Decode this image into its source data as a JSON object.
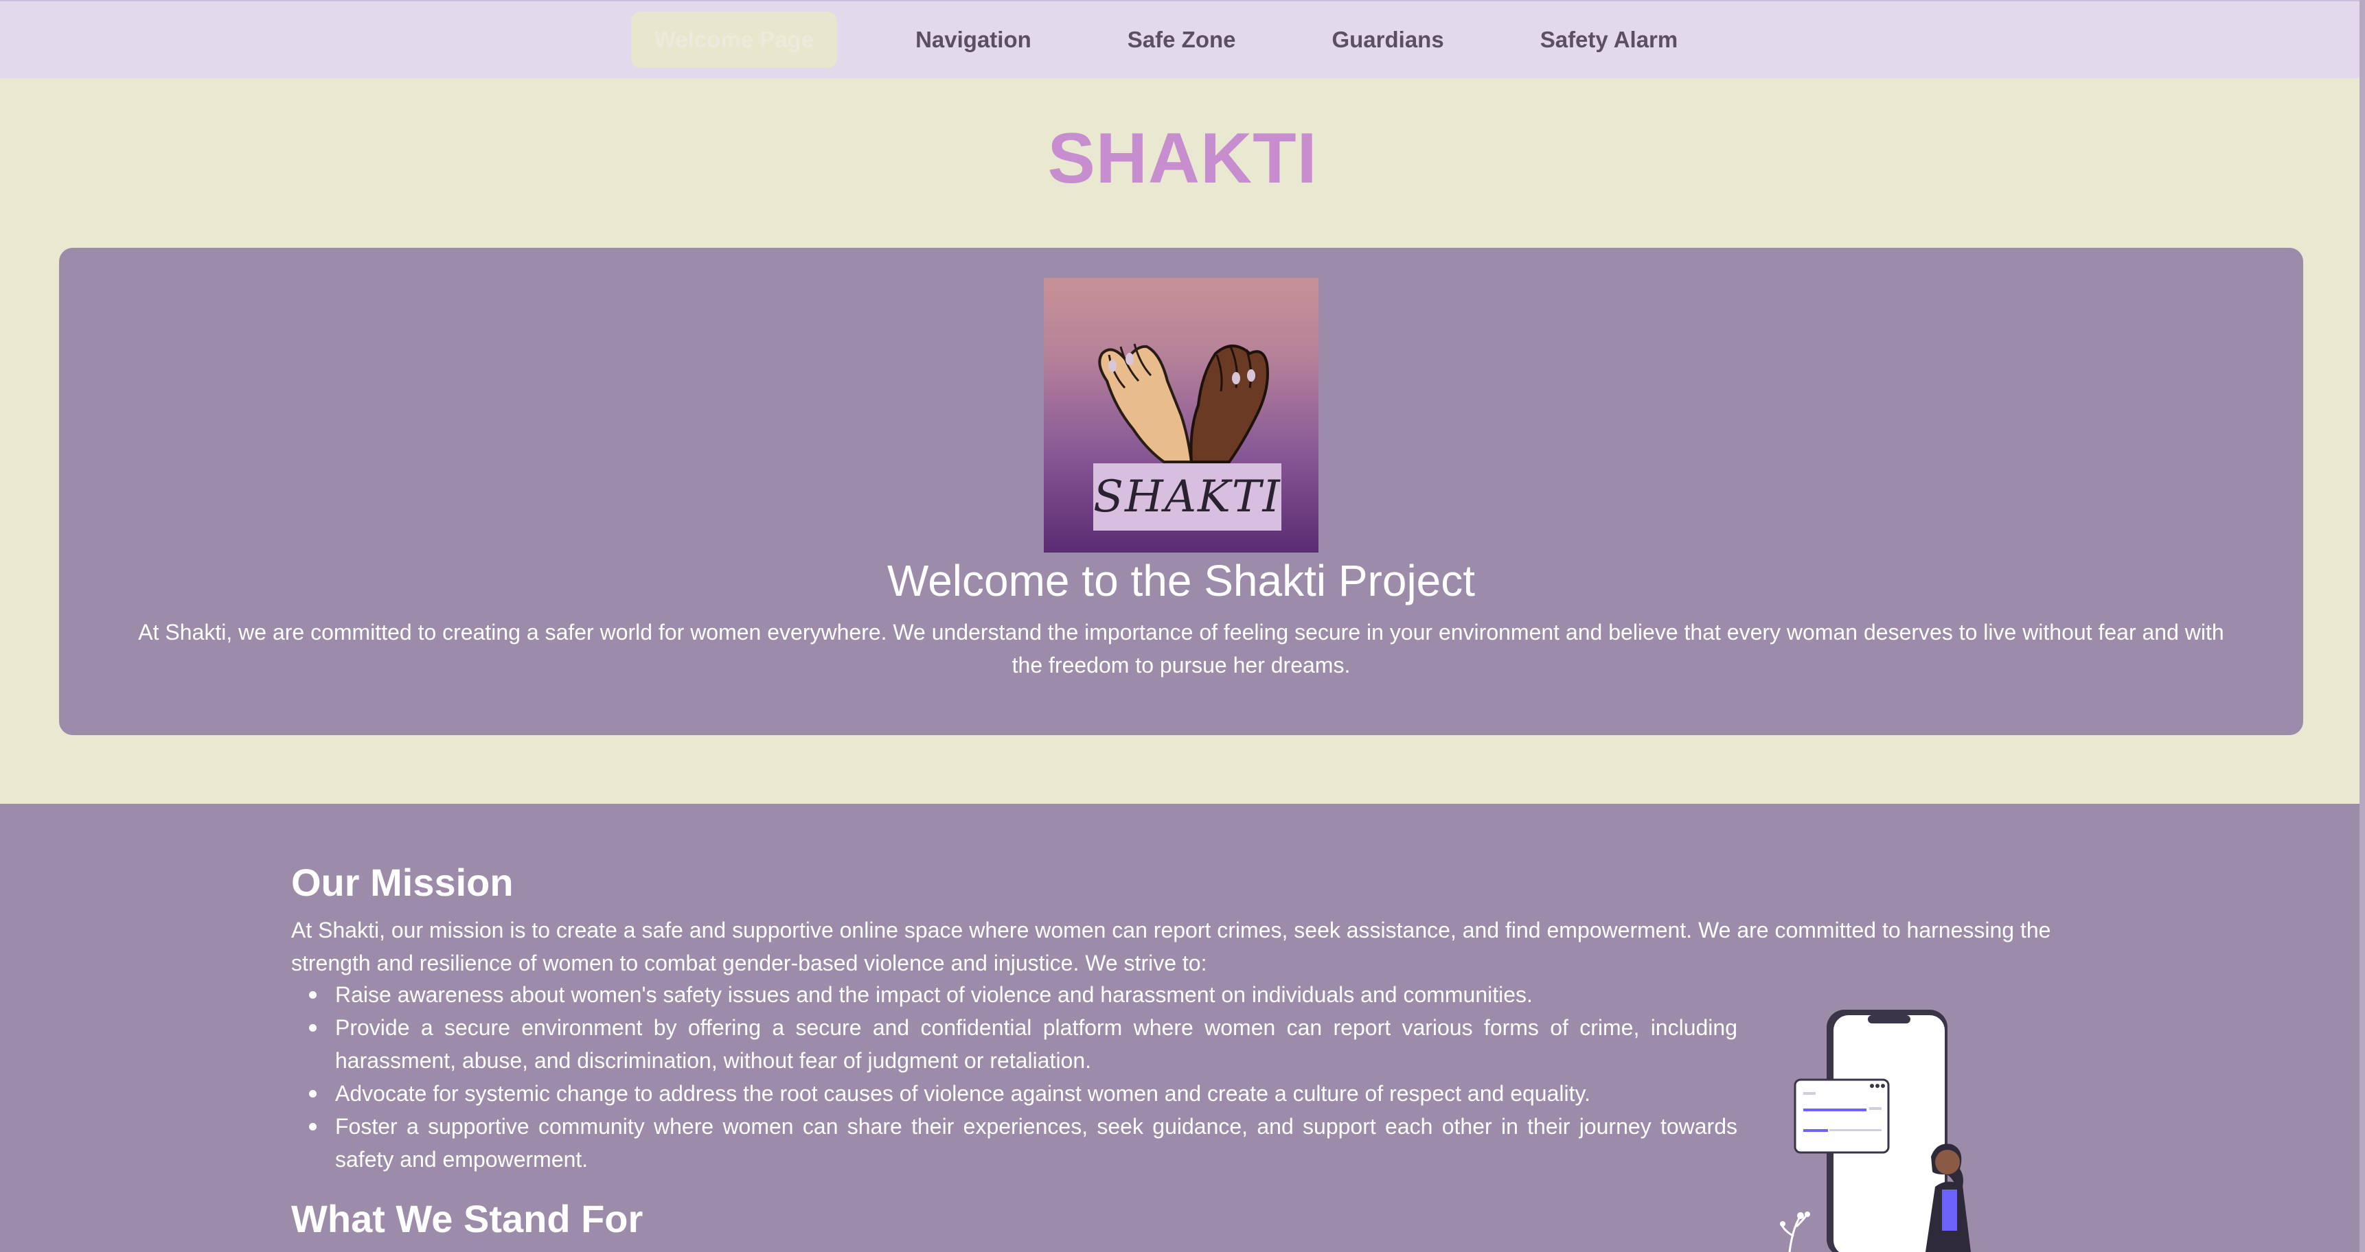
{
  "nav": {
    "items": [
      {
        "label": "Welcome Page",
        "active": true
      },
      {
        "label": "Navigation",
        "active": false
      },
      {
        "label": "Safe Zone",
        "active": false
      },
      {
        "label": "Guardians",
        "active": false
      },
      {
        "label": "Safety Alarm",
        "active": false
      }
    ]
  },
  "site": {
    "title": "SHAKTI"
  },
  "hero": {
    "logo_text": "SHAKTI",
    "heading": "Welcome to the Shakti Project",
    "text": "At Shakti, we are committed to creating a safer world for women everywhere. We understand the importance of feeling secure in your environment and believe that every woman deserves to live without fear and with the freedom to pursue her dreams."
  },
  "mission": {
    "heading": "Our Mission",
    "text": "At Shakti, our mission is to create a safe and supportive online space where women can report crimes, seek assistance, and find empowerment. We are committed to harnessing the strength and resilience of women to combat gender-based violence and injustice. We strive to:",
    "items": [
      "Raise awareness about women's safety issues and the impact of violence and harassment on individuals and communities.",
      "Provide a secure environment by offering a secure and confidential platform where women can report various forms of crime, including harassment, abuse, and discrimination, without fear of judgment or retaliation.",
      "Advocate for systemic change to address the root causes of violence against women and create a culture of respect and equality.",
      "Foster a supportive community where women can share their experiences, seek guidance, and support each other in their journey towards safety and empowerment."
    ]
  },
  "stand": {
    "heading": "What We Stand For"
  },
  "colors": {
    "nav_bg": "#e2d9ec",
    "page_bg": "#e9e8d1",
    "card_bg": "#9c8ba9",
    "title": "#c78ecf"
  },
  "icons": {
    "logo": "pinky-promise-hands-logo",
    "illustration": "woman-with-phone-illustration"
  }
}
